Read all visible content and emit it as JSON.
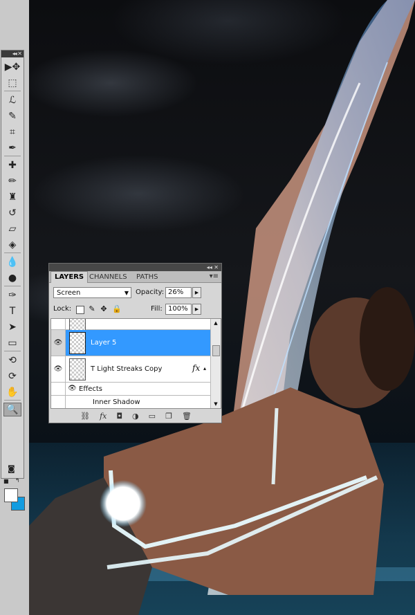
{
  "tools_panel": {
    "title_glyph": "◂◂ ✕",
    "tools": [
      {
        "name": "move-tool-icon",
        "glyph": "▶✥"
      },
      {
        "name": "marquee-tool-icon",
        "glyph": "⬚"
      },
      {
        "name": "lasso-tool-icon",
        "glyph": "ℒ"
      },
      {
        "name": "quick-selection-tool-icon",
        "glyph": "✎"
      },
      {
        "name": "crop-tool-icon",
        "glyph": "⌗"
      },
      {
        "name": "eyedropper-tool-icon",
        "glyph": "✒"
      },
      {
        "name": "healing-brush-tool-icon",
        "glyph": "✚"
      },
      {
        "name": "brush-tool-icon",
        "glyph": "✏"
      },
      {
        "name": "clone-stamp-tool-icon",
        "glyph": "♜"
      },
      {
        "name": "history-brush-tool-icon",
        "glyph": "↺"
      },
      {
        "name": "eraser-tool-icon",
        "glyph": "▱"
      },
      {
        "name": "paint-bucket-tool-icon",
        "glyph": "◈"
      },
      {
        "name": "blur-tool-icon",
        "glyph": "💧"
      },
      {
        "name": "dodge-tool-icon",
        "glyph": "●"
      },
      {
        "name": "pen-tool-icon",
        "glyph": "✑"
      },
      {
        "name": "type-tool-icon",
        "glyph": "T"
      },
      {
        "name": "path-selection-tool-icon",
        "glyph": "➤"
      },
      {
        "name": "rectangle-tool-icon",
        "glyph": "▭"
      },
      {
        "name": "3d-rotate-tool-icon",
        "glyph": "⟲"
      },
      {
        "name": "3d-orbit-tool-icon",
        "glyph": "⟳"
      },
      {
        "name": "hand-tool-icon",
        "glyph": "✋"
      },
      {
        "name": "zoom-tool-icon",
        "glyph": "🔍"
      }
    ],
    "active_tool": "zoom-tool-icon",
    "foreground_color": "#ffffff",
    "background_color": "#129ce0"
  },
  "layers_panel": {
    "title_glyph": "◂◂ ✕",
    "tabs": [
      "LAYERS",
      "CHANNELS",
      "PATHS"
    ],
    "active_tab": "LAYERS",
    "menu_glyph": "▾≡",
    "blend_mode": "Screen",
    "opacity_label": "Opacity:",
    "opacity_value": "26%",
    "lock_label": "Lock:",
    "fill_label": "Fill:",
    "fill_value": "100%",
    "layers": [
      {
        "name": "",
        "visible": false,
        "selected": false
      },
      {
        "name": "Layer 5",
        "visible": true,
        "selected": true
      },
      {
        "name": "T Light Streaks Copy",
        "visible": true,
        "selected": false,
        "fx": "fx"
      }
    ],
    "effects_label": "Effects",
    "inner_shadow_label": "Inner Shadow",
    "selected_color": "#3399ff"
  }
}
